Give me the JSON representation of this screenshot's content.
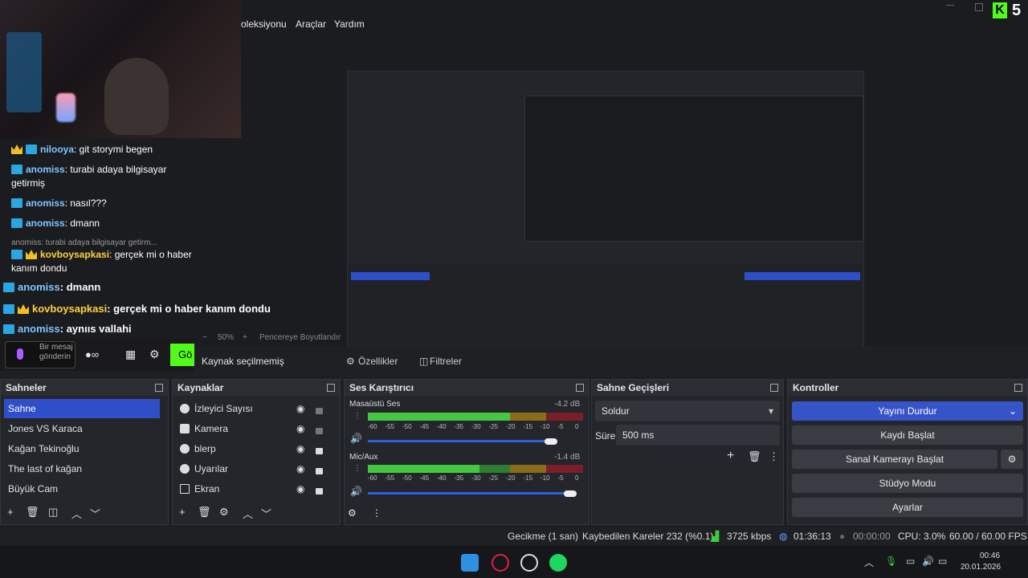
{
  "menu": {
    "items": [
      "oleksiyonu",
      "Araçlar",
      "Yardım"
    ]
  },
  "brand": {
    "logo": "K",
    "count": "5"
  },
  "chat": {
    "lines": [
      {
        "user": "nilooya",
        "text": ": git storymi begen"
      },
      {
        "user": "anomiss",
        "text": ": turabi adaya bilgisayar getirmiş"
      },
      {
        "user": "anomiss",
        "text": ": nasıl???"
      },
      {
        "user": "anomiss",
        "text": ": dmann"
      },
      {
        "reply": "anomiss: turabi adaya bilgisayar getirm..."
      },
      {
        "user": "kovboysapkasi",
        "text": ": gerçek mi o haber kanım dondu"
      }
    ],
    "big": [
      {
        "user": "anomiss",
        "text": ": dmann"
      },
      {
        "user": "kovboysapkasi",
        "text": ": gerçek mi o haber kanım dondu"
      },
      {
        "user": "anomiss",
        "text": ": aynııs vallahi"
      }
    ],
    "input_placeholder": "Bir mesaj gönderin",
    "send_label": "Gö"
  },
  "zoom": {
    "value": "50%",
    "fit_label": "Pencereye Boyutlandır"
  },
  "subbar": {
    "no_source": "Kaynak seçilmemiş",
    "properties": "Özellikler",
    "filters": "Filtreler"
  },
  "scenes": {
    "title": "Sahneler",
    "items": [
      "Sahne",
      "Jones VS Karaca",
      "Kağan Tekinoğlu",
      "The last of kağan",
      "Büyük Cam"
    ]
  },
  "sources": {
    "title": "Kaynaklar",
    "items": [
      "İzleyici Sayısı",
      "Kamera",
      "blerp",
      "Uyarılar",
      "Ekran"
    ]
  },
  "mixer": {
    "title": "Ses Karıştırıcı",
    "channels": [
      {
        "name": "Masaüstü Ses",
        "db": "-4.2 dB",
        "level": 0.93,
        "volume": 0.85
      },
      {
        "name": "Mic/Aux",
        "db": "-1.4 dB",
        "level": 0.52,
        "volume": 0.94
      }
    ],
    "scale": [
      "-60",
      "-55",
      "-50",
      "-45",
      "-40",
      "-35",
      "-30",
      "-25",
      "-20",
      "-15",
      "-10",
      "-5",
      "0"
    ]
  },
  "transitions": {
    "title": "Sahne Geçişleri",
    "selected": "Soldur",
    "duration_label": "Süre",
    "duration_value": "500 ms"
  },
  "controls": {
    "title": "Kontroller",
    "stop_stream": "Yayını Durdur",
    "start_recording": "Kaydı Başlat",
    "virtual_cam": "Sanal Kamerayı Başlat",
    "studio_mode": "Stüdyo Modu",
    "settings": "Ayarlar"
  },
  "status": {
    "delay": "Gecikme (1 san)",
    "dropped": "Kaybedilen Kareler 232 (%0.1)",
    "bitrate": "3725 kbps",
    "stream_time": "01:36:13",
    "rec_time": "00:00:00",
    "cpu": "CPU: 3.0%",
    "fps": "60.00 / 60.00 FPS"
  },
  "taskbar": {
    "time": "00:46",
    "date": "20.01.2026"
  },
  "colors": {
    "accent": "#2f4fc9",
    "meter_green": "#2e7d32",
    "meter_yellow": "#8a6d1a",
    "meter_red": "#7a1f2a",
    "twitch_green": "#53fc18"
  }
}
